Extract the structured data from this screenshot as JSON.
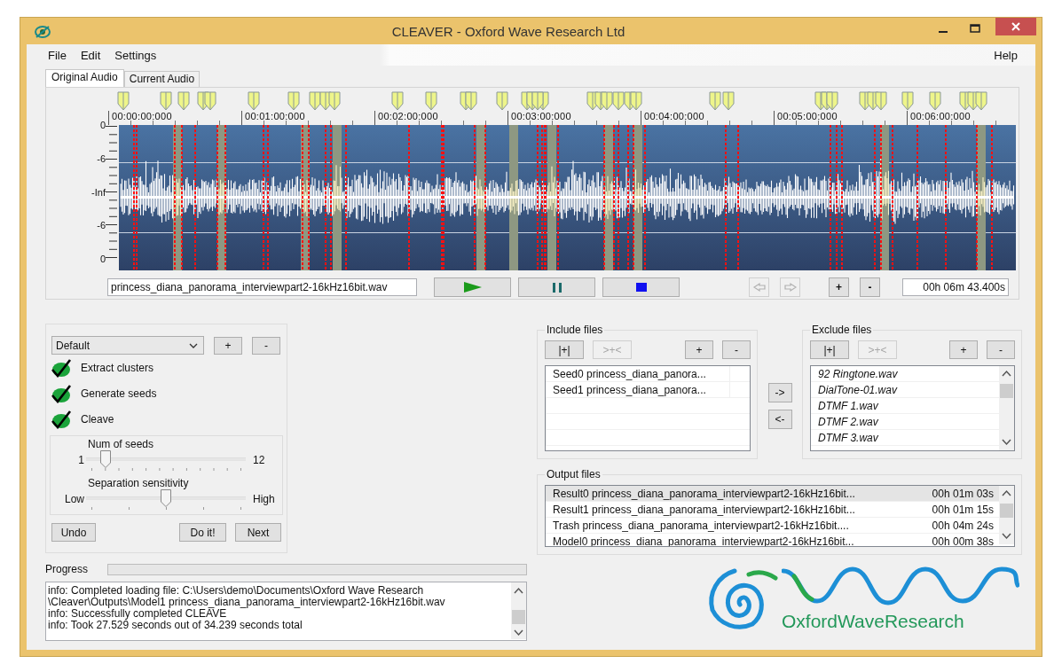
{
  "window": {
    "title": "CLEAVER - Oxford Wave Research Ltd"
  },
  "menu": [
    {
      "label": "File"
    },
    {
      "label": "Edit"
    },
    {
      "label": "Settings"
    }
  ],
  "help_menu": {
    "label": "Help"
  },
  "tabs": [
    {
      "label": "Original Audio",
      "selected": true
    },
    {
      "label": "Current Audio",
      "selected": false
    }
  ],
  "waveform": {
    "time_labels": [
      "00:00:00:000",
      "00:01:00:000",
      "00:02:00:000",
      "00:03:00:000",
      "00:04:00:000",
      "00:05:00:000",
      "00:06:00:000"
    ],
    "level_labels": [
      "0",
      "-6",
      "-Inf",
      "-6",
      "0"
    ],
    "file_name": "princess_diana_panorama_interviewpart2-16kHz16bit.wav",
    "nav_buttons": [
      {
        "disabled": true
      },
      {
        "disabled": true
      }
    ],
    "zoom_buttons": [
      "+",
      "-"
    ],
    "duration": "00h 06m 43.400s"
  },
  "preset": {
    "value": "Default",
    "buttons": [
      "+",
      "-"
    ]
  },
  "options": [
    {
      "label": "Extract clusters",
      "checked": true
    },
    {
      "label": "Generate seeds",
      "checked": true
    },
    {
      "label": "Cleave",
      "checked": true
    }
  ],
  "sliders": [
    {
      "label": "Num of seeds",
      "min_label": "1",
      "max_label": "12",
      "level": 0.12
    },
    {
      "label": "Separation sensitivity",
      "min_label": "Low",
      "max_label": "High",
      "level": 0.5
    }
  ],
  "actions": [
    "Undo",
    "Do it!",
    "Next"
  ],
  "include": {
    "title": "Include files",
    "buttons": [
      {
        "label": "|+|",
        "disabled": false
      },
      {
        "label": ">+<",
        "disabled": true
      },
      {
        "label": "+",
        "disabled": false
      },
      {
        "label": "-",
        "disabled": false
      }
    ],
    "items": [
      "Seed0 princess_diana_panora...",
      "Seed1 princess_diana_panora..."
    ]
  },
  "move_buttons": [
    "->",
    "<-"
  ],
  "exclude": {
    "title": "Exclude files",
    "buttons": [
      {
        "label": "|+|",
        "disabled": false
      },
      {
        "label": ">+<",
        "disabled": true
      },
      {
        "label": "+",
        "disabled": false
      },
      {
        "label": "-",
        "disabled": false
      }
    ],
    "items": [
      "92 Ringtone.wav",
      "DialTone-01.wav",
      "DTMF 1.wav",
      "DTMF 2.wav",
      "DTMF 3.wav"
    ]
  },
  "output": {
    "title": "Output files",
    "rows": [
      {
        "name": "Result0 princess_diana_panorama_interviewpart2-16kHz16bit...",
        "duration": "00h 01m 03s",
        "selected": true
      },
      {
        "name": "Result1 princess_diana_panorama_interviewpart2-16kHz16bit...",
        "duration": "00h 01m 15s",
        "selected": false
      },
      {
        "name": "Trash princess_diana_panorama_interviewpart2-16kHz16bit....",
        "duration": "00h 04m 24s",
        "selected": false
      },
      {
        "name": "Model0 princess_diana_panorama_interviewpart2-16kHz16bit...",
        "duration": "00h 00m 38s",
        "selected": false
      }
    ]
  },
  "progress": {
    "label": "Progress"
  },
  "log": [
    "info: Completed loading file: C:\\Users\\demo\\Documents\\Oxford Wave Research",
    "\\Cleaver\\Outputs\\Model1 princess_diana_panorama_interviewpart2-16kHz16bit.wav",
    "info: Successfully completed CLEAVE",
    "info: Took 27.529 seconds out of 34.239 seconds total"
  ],
  "logo": {
    "text": "OxfordWaveResearch"
  }
}
